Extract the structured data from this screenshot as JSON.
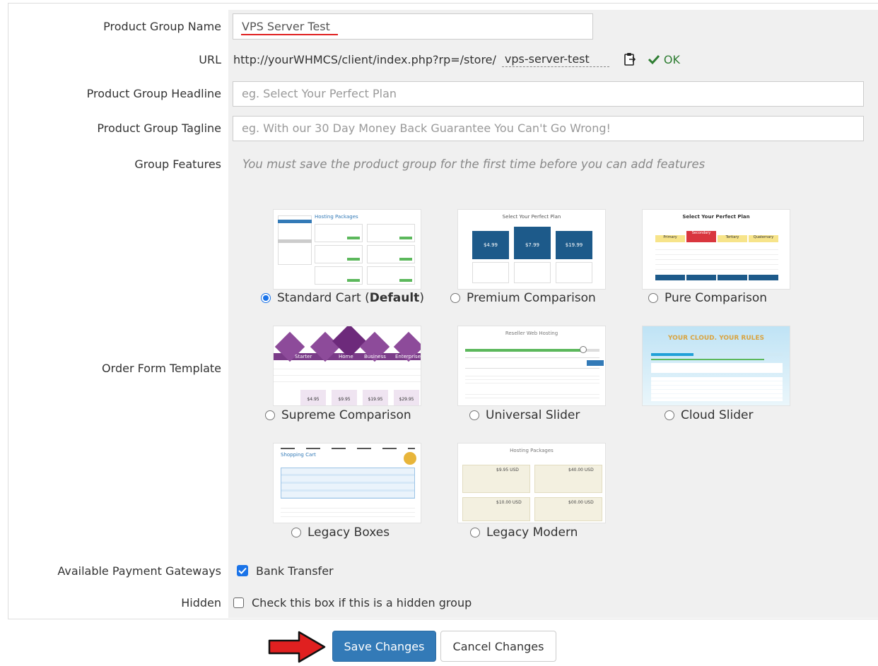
{
  "form": {
    "group_name": {
      "label": "Product Group Name",
      "value": "VPS Server Test"
    },
    "url": {
      "label": "URL",
      "prefix": "http://yourWHMCS/client/index.php?rp=/store/",
      "slug": "vps-server-test",
      "status": "OK"
    },
    "headline": {
      "label": "Product Group Headline",
      "placeholder": "eg. Select Your Perfect Plan"
    },
    "tagline": {
      "label": "Product Group Tagline",
      "placeholder": "eg. With our 30 Day Money Back Guarantee You Can't Go Wrong!"
    },
    "features": {
      "label": "Group Features",
      "note": "You must save the product group for the first time before you can add features"
    },
    "template": {
      "label": "Order Form Template",
      "options": [
        {
          "label": "Standard Cart (",
          "bold": "Default",
          "suffix": ")",
          "selected": true
        },
        {
          "label": "Premium Comparison",
          "selected": false
        },
        {
          "label": "Pure Comparison",
          "selected": false
        },
        {
          "label": "Supreme Comparison",
          "selected": false
        },
        {
          "label": "Universal Slider",
          "selected": false
        },
        {
          "label": "Cloud Slider",
          "selected": false
        },
        {
          "label": "Legacy Boxes",
          "selected": false
        },
        {
          "label": "Legacy Modern",
          "selected": false
        }
      ],
      "thumb_text": {
        "standard_title": "Hosting Packages",
        "premium_title": "Select Your Perfect Plan",
        "premium_prices": [
          "$4.99",
          "$7.99",
          "$19.99"
        ],
        "pure_title": "Select Your Perfect Plan",
        "pure_plans": [
          "Primary",
          "Secondary",
          "Tertiary",
          "Quaternary"
        ],
        "supreme_plans": [
          "Starter",
          "Home",
          "Business",
          "Enterprise"
        ],
        "supreme_prices": [
          "$4.95",
          "$9.95",
          "$19.95",
          "$29.95"
        ],
        "universal_title": "Reseller Web Hosting",
        "cloud_title": "YOUR CLOUD. YOUR RULES",
        "legacy_boxes_title": "Shopping Cart",
        "legacy_modern_title": "Hosting Packages",
        "legacy_modern_prices": [
          "$9.95 USD",
          "$40.00 USD",
          "$10.00 USD",
          "$00.00 USD"
        ]
      }
    },
    "gateways": {
      "label": "Available Payment Gateways",
      "option": "Bank Transfer",
      "checked": true
    },
    "hidden": {
      "label": "Hidden",
      "option": "Check this box if this is a hidden group",
      "checked": false
    }
  },
  "buttons": {
    "save": "Save Changes",
    "cancel": "Cancel Changes"
  },
  "colors": {
    "primary": "#337ab7",
    "ok": "#2e7d32",
    "annotation": "#e02020",
    "label_bg": "#ffffff",
    "field_bg": "#f0f0f0"
  },
  "icons": {
    "copy": "clipboard-icon",
    "ok": "checkmark-icon",
    "annotation": "red-arrow-icon"
  }
}
